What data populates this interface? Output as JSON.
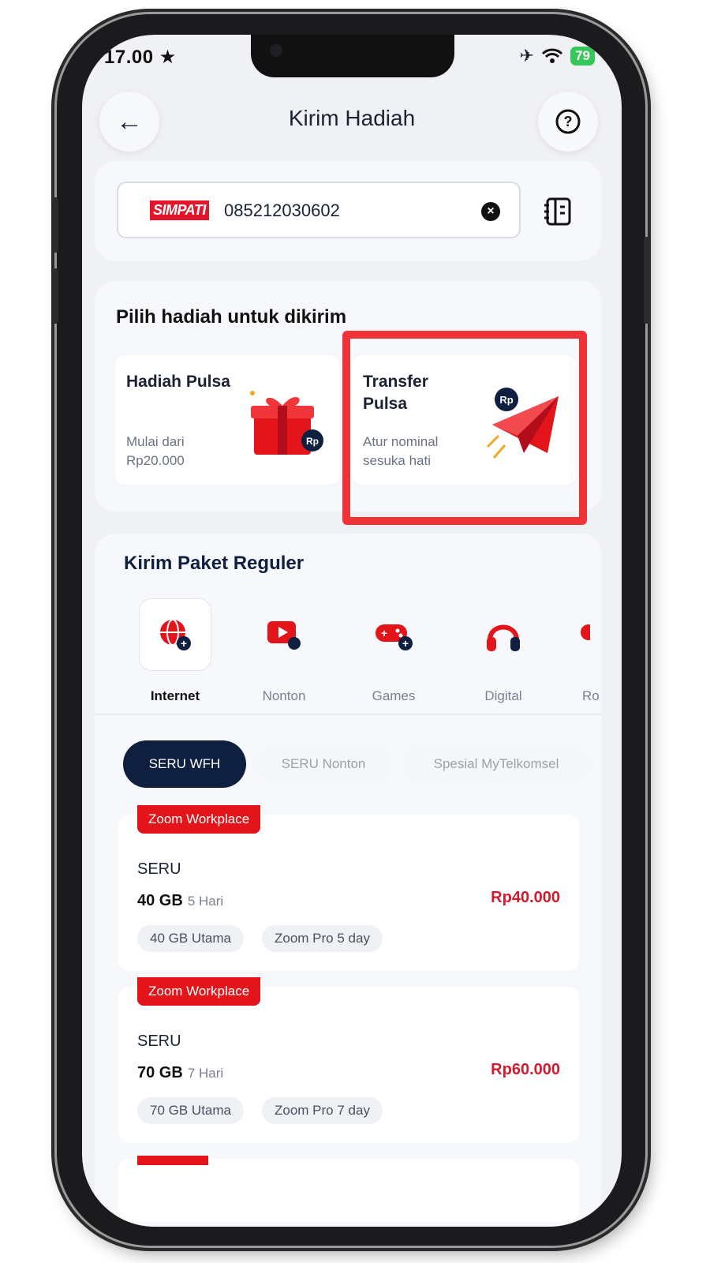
{
  "status": {
    "time": "17.00 ★",
    "battery": "79"
  },
  "header": {
    "title": "Kirim Hadiah"
  },
  "recipient": {
    "provider": "SIMPATI",
    "number": "085212030602"
  },
  "gift_section": {
    "title": "Pilih hadiah untuk dikirim",
    "options": [
      {
        "title": "Hadiah Pulsa",
        "subtitle": "Mulai dari Rp20.000"
      },
      {
        "title": "Transfer Pulsa",
        "subtitle": "Atur nominal sesuka hati"
      }
    ]
  },
  "paket": {
    "title": "Kirim Paket Reguler",
    "categories": [
      "Internet",
      "Nonton",
      "Games",
      "Digital",
      "Ro"
    ],
    "chips": [
      "SERU WFH",
      "SERU Nonton",
      "Spesial MyTelkomsel"
    ],
    "items": [
      {
        "tag": "Zoom Workplace",
        "name": "SERU",
        "quota": "40 GB",
        "days": "5 Hari",
        "price": "Rp40.000",
        "features": [
          "40 GB Utama",
          "Zoom Pro 5 day"
        ]
      },
      {
        "tag": "Zoom Workplace",
        "name": "SERU",
        "quota": "70 GB",
        "days": "7 Hari",
        "price": "Rp60.000",
        "features": [
          "70 GB Utama",
          "Zoom Pro 7 day"
        ]
      }
    ]
  },
  "colors": {
    "accent": "#e3151b",
    "navy": "#0f1f3f",
    "highlight": "#f03338"
  }
}
